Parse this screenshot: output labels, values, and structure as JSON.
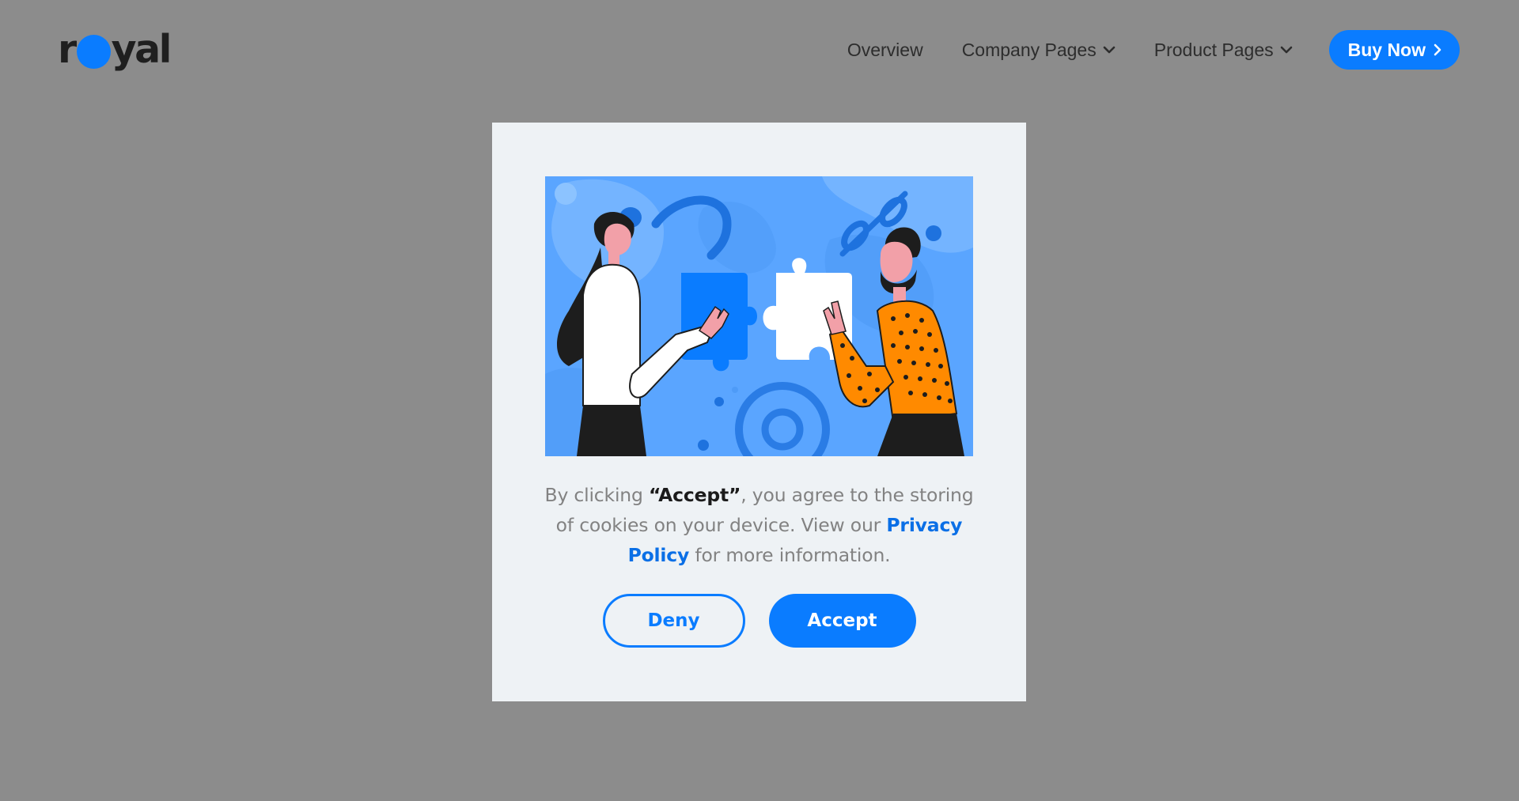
{
  "header": {
    "logo": {
      "before": "r",
      "after": "yal"
    },
    "nav": [
      {
        "label": "Overview",
        "has_dropdown": false
      },
      {
        "label": "Company Pages",
        "has_dropdown": true
      },
      {
        "label": "Product Pages",
        "has_dropdown": true
      }
    ],
    "cta_label": "Buy Now"
  },
  "modal": {
    "text": {
      "part1": "By clicking ",
      "accept_quote": "“Accept”",
      "part2": ", you agree to the storing of cookies on your device. View our ",
      "privacy_link": "Privacy Policy",
      "part3": " for more information."
    },
    "deny_label": "Deny",
    "accept_label": "Accept"
  },
  "colors": {
    "accent": "#0a7cff",
    "backdrop": "#8c8c8c",
    "modal_bg": "#eef2f5",
    "illustration_bg": "#5aa5ff",
    "shirt_orange": "#ff8a00"
  }
}
